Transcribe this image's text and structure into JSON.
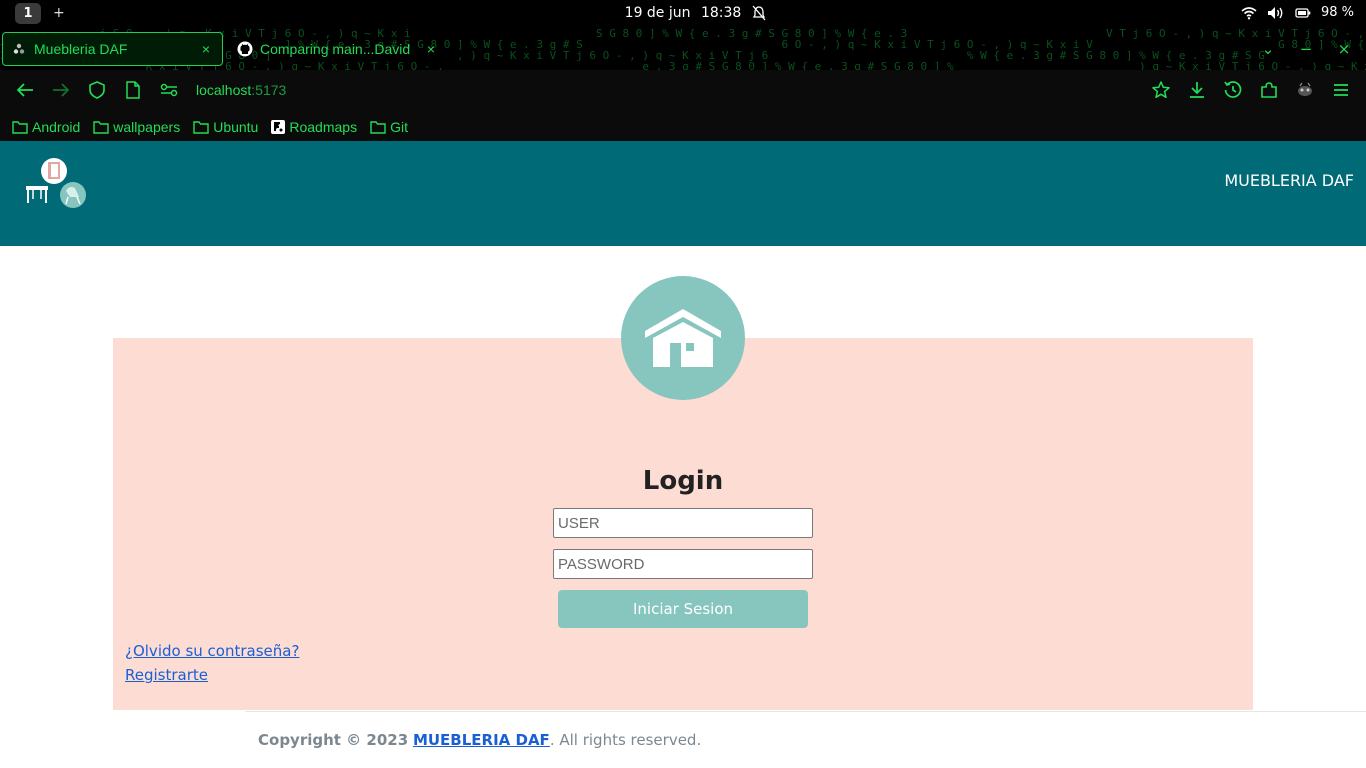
{
  "os": {
    "workspace": "1",
    "new_workspace": "+",
    "date": "19 de jun",
    "time": "18:38",
    "battery": "98 %"
  },
  "browser": {
    "tabs": [
      {
        "label": "Muebleria DAF",
        "icon": "favicon-dots-icon",
        "active": true
      },
      {
        "label": "Comparing main...David",
        "icon": "github-icon",
        "active": false
      }
    ],
    "tab_close": "×",
    "url_host": "localhost",
    "url_port": ":5173",
    "window_controls": [
      "⌄",
      "−",
      "×"
    ],
    "bookmarks": [
      {
        "label": "Android",
        "icon": "folder-icon"
      },
      {
        "label": "wallpapers",
        "icon": "folder-icon"
      },
      {
        "label": "Ubuntu",
        "icon": "folder-icon"
      },
      {
        "label": "Roadmaps",
        "icon": "roadmaps-icon"
      },
      {
        "label": "Git",
        "icon": "folder-icon"
      }
    ],
    "accent_color": "#22dd55"
  },
  "site": {
    "brand": "MUEBLERIA DAF",
    "header_color": "#006b76",
    "panel_color": "#fddcd3",
    "accent_color": "#87c5bf"
  },
  "login": {
    "title": "Login",
    "user_placeholder": "USER",
    "password_placeholder": "PASSWORD",
    "submit_label": "Iniciar Sesion",
    "forgot_link": "¿Olvido su contraseña?",
    "register_link": "Registrarte"
  },
  "footer": {
    "copyright_prefix": "Copyright © 2023",
    "brand_link": "MUEBLERIA DAF",
    "suffix": ". All rights reserved."
  }
}
